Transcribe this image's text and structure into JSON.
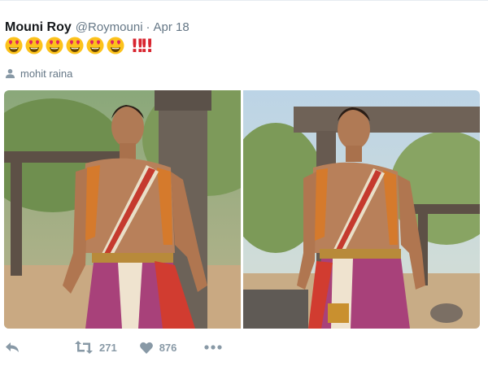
{
  "tweet": {
    "author_name": "Mouni Roy",
    "author_handle": "@Roymouni",
    "separator": "·",
    "date": "Apr 18",
    "emojis": [
      "heart-eyes-emoji",
      "heart-eyes-emoji",
      "heart-eyes-emoji",
      "heart-eyes-emoji",
      "heart-eyes-emoji",
      "heart-eyes-emoji"
    ],
    "exclamations": "‼‼",
    "tagged_person": "mohit raina",
    "media_count": 2
  },
  "actions": {
    "reply_icon": "reply-icon",
    "retweet_icon": "retweet-icon",
    "retweet_count": "271",
    "like_icon": "heart-icon",
    "like_count": "876",
    "more_icon": "more-icon"
  },
  "colors": {
    "name": "#14171a",
    "secondary": "#657786",
    "action": "#8899a6",
    "bang": "#d8252f"
  }
}
